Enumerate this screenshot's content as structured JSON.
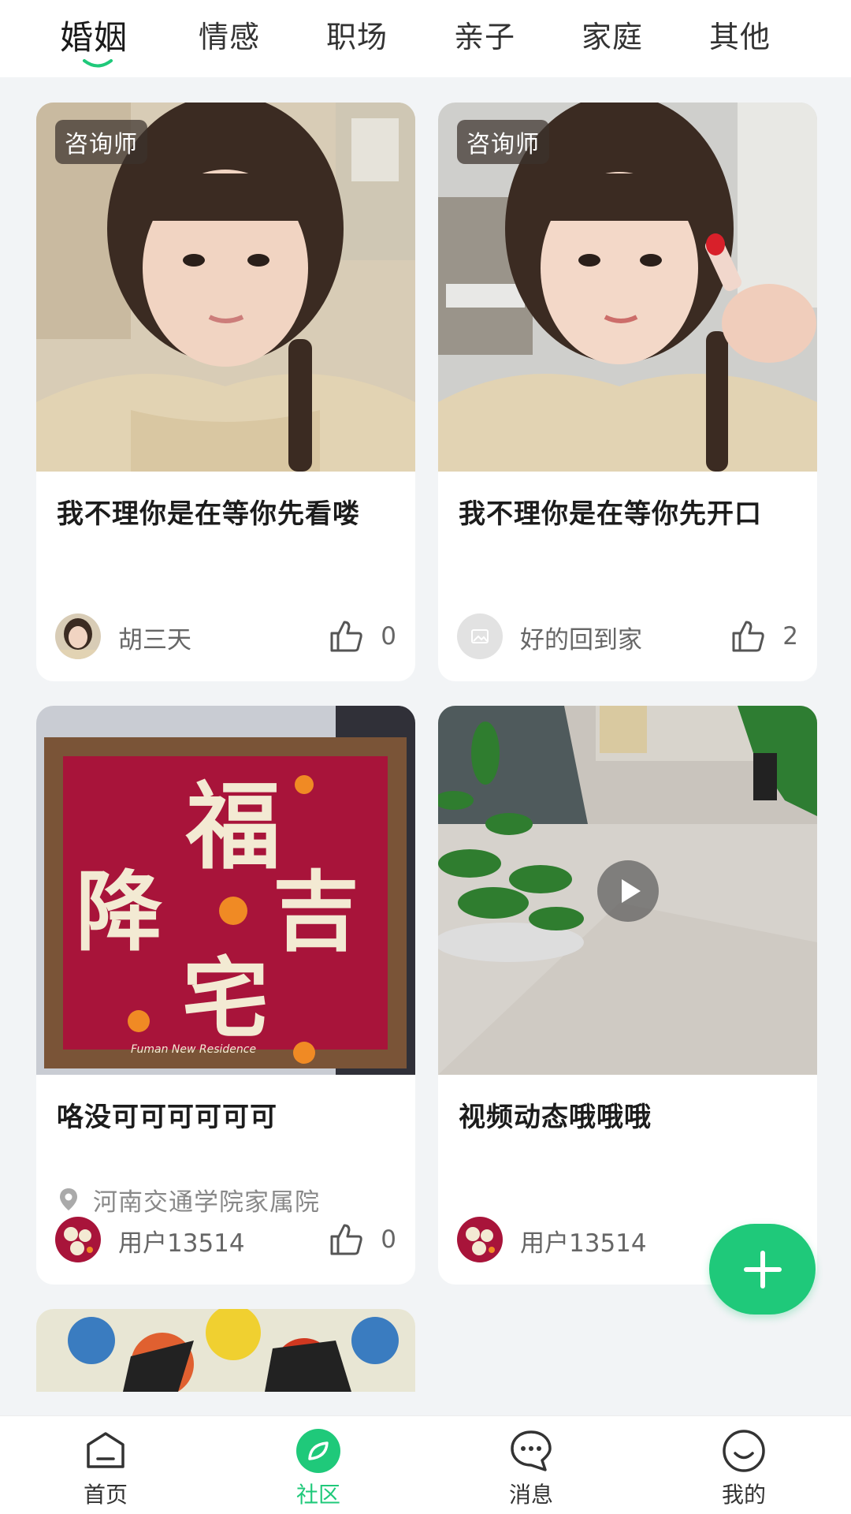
{
  "tabs": [
    {
      "label": "婚姻",
      "active": true
    },
    {
      "label": "情感"
    },
    {
      "label": "职场"
    },
    {
      "label": "亲子"
    },
    {
      "label": "家庭"
    },
    {
      "label": "其他"
    }
  ],
  "cards": [
    {
      "tag": "咨询师",
      "title": "我不理你是在等你先看喽",
      "author": "胡三天",
      "likes": "0"
    },
    {
      "tag": "咨询师",
      "title": "我不理你是在等你先开口",
      "author": "好的回到家",
      "likes": "2"
    },
    {
      "title": "咯没可可可可可可",
      "location": "河南交通学院家属院",
      "author": "用户13514",
      "likes": "0"
    },
    {
      "title": "视频动态哦哦哦",
      "author": "用户13514",
      "has_video": true
    }
  ],
  "artwork_text": {
    "line1": "福",
    "line2a": "降",
    "line2b": "吉",
    "line3": "宅",
    "caption": "Fuman New Residence"
  },
  "bottom_nav": [
    {
      "label": "首页",
      "icon": "home-icon"
    },
    {
      "label": "社区",
      "icon": "community-icon",
      "active": true
    },
    {
      "label": "消息",
      "icon": "message-icon"
    },
    {
      "label": "我的",
      "icon": "profile-icon"
    }
  ],
  "colors": {
    "accent": "#1fc97a",
    "background": "#f2f4f6"
  }
}
